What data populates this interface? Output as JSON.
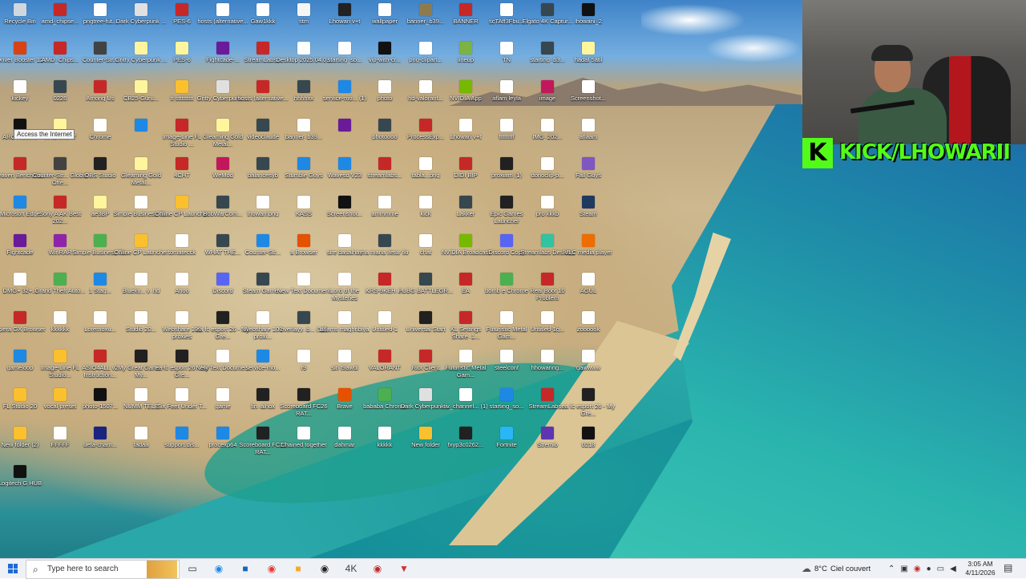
{
  "tooltip": "Access the Internet",
  "desktop_icons": [
    {
      "label": "Recycle Bin",
      "color": "#cfd8dc"
    },
    {
      "label": "amd_chipse...",
      "color": "#c62828"
    },
    {
      "label": "pngtree-fut...",
      "color": "#ffffff"
    },
    {
      "label": "Dark Cyberpunk ...",
      "color": "#e0e0e0"
    },
    {
      "label": "PES-6",
      "color": "#c62828"
    },
    {
      "label": "hosts (alternative...",
      "color": "#ffffff"
    },
    {
      "label": "Gaw1kkk",
      "color": "#ffffff"
    },
    {
      "label": "stm",
      "color": "#f5f5f5"
    },
    {
      "label": "Lhowari v+t",
      "color": "#222222"
    },
    {
      "label": "wallpaper",
      "color": "#ffffff"
    },
    {
      "label": "banner_b39...",
      "color": "#8d7b4f"
    },
    {
      "label": "BANNER",
      "color": "#c62828"
    },
    {
      "label": "scTAff3Fbu...",
      "color": "#ffffff"
    },
    {
      "label": "Elgato 4K Captur...",
      "color": "#37474f"
    },
    {
      "label": "lhowarii_2",
      "color": "#111111"
    },
    {
      "label": "Driver Booster 12",
      "color": "#d84315"
    },
    {
      "label": "AMD_Chips...",
      "color": "#c62828"
    },
    {
      "label": "Counter-Str...",
      "color": "#424242"
    },
    {
      "label": "Gritty Cyberpunk ...",
      "color": "#fff59d"
    },
    {
      "label": "PES-6",
      "color": "#fff59d"
    },
    {
      "label": "Fightcade-...",
      "color": "#6a1b9a"
    },
    {
      "label": "StreamLabs...",
      "color": "#c62828"
    },
    {
      "label": "Desktop 2025.04.0...",
      "color": "#ffffff"
    },
    {
      "label": "starting_so...",
      "color": "#ffffff"
    },
    {
      "label": "vip-with-cr...",
      "color": "#111111"
    },
    {
      "label": "png-clipart...",
      "color": "#ffffff"
    },
    {
      "label": "lineup",
      "color": "#7cb342"
    },
    {
      "label": "TN",
      "color": "#ffffff"
    },
    {
      "label": "starting_b3...",
      "color": "#37474f"
    },
    {
      "label": "hadaf 5atil",
      "color": "#fff59d"
    },
    {
      "label": "kickey",
      "color": "#ffffff"
    },
    {
      "label": "0226",
      "color": "#37474f"
    },
    {
      "label": "Among Us",
      "color": "#c62828"
    },
    {
      "label": "CB25-Guru...",
      "color": "#fff59d"
    },
    {
      "label": "ft sttttttttt",
      "color": "#fbc02d"
    },
    {
      "label": "Gritty Cyberpunk ...",
      "color": "#e0e0e0"
    },
    {
      "label": "hosts (alternative...",
      "color": "#c62828"
    },
    {
      "label": "hhhhxx",
      "color": "#37474f"
    },
    {
      "label": "service-mo... (1)",
      "color": "#1e88e5"
    },
    {
      "label": "photo",
      "color": "#ffffff"
    },
    {
      "label": "hd-valorant...",
      "color": "#ffffff"
    },
    {
      "label": "NVIDIA App",
      "color": "#76b900"
    },
    {
      "label": "aflam leyla",
      "color": "#ffffff"
    },
    {
      "label": "image",
      "color": "#c2185b"
    },
    {
      "label": "Screenshot...",
      "color": "#ffffff"
    },
    {
      "label": "ARC Raiders",
      "color": "#111111"
    },
    {
      "label": "deepfakeRT",
      "color": "#fff59d"
    },
    {
      "label": "Chrome",
      "color": "#ffffff"
    },
    {
      "label": "",
      "color": "#1e88e5"
    },
    {
      "label": "Image-Line FL Studio ...",
      "color": "#c62828"
    },
    {
      "label": "Gleaming Gold Metal...",
      "color": "#fff59d"
    },
    {
      "label": "videoclaude",
      "color": "#37474f"
    },
    {
      "label": "banner_b39...",
      "color": "#ffffff"
    },
    {
      "label": "",
      "color": "#6a1b9a"
    },
    {
      "label": "photoooo",
      "color": "#37474f"
    },
    {
      "label": "ProcessExp...",
      "color": "#c62828"
    },
    {
      "label": "Lhowari v+t",
      "color": "#ffffff"
    },
    {
      "label": "ffffffffff",
      "color": "#ffffff"
    },
    {
      "label": "IMG_202...",
      "color": "#ffffff"
    },
    {
      "label": "aflaam",
      "color": "#ffffff"
    },
    {
      "label": "Heaven Benchma...",
      "color": "#c62828"
    },
    {
      "label": "Counter-Str... Global Offe...",
      "color": "#424242"
    },
    {
      "label": "OBS Studio",
      "color": "#212121"
    },
    {
      "label": "Gleaming Gold Metal...",
      "color": "#fff59d"
    },
    {
      "label": "4CHT",
      "color": "#c62828"
    },
    {
      "label": "WeMod",
      "color": "#c2185b"
    },
    {
      "label": "balancesyb",
      "color": "#37474f"
    },
    {
      "label": "Stumble Guys",
      "color": "#1e88e5"
    },
    {
      "label": "Wavesd V23",
      "color": "#1e88e5"
    },
    {
      "label": "streamlabs...",
      "color": "#c62828"
    },
    {
      "label": "tabla...png",
      "color": "#ffffff"
    },
    {
      "label": "DIDI BIP",
      "color": "#c62828"
    },
    {
      "label": "proxiam (1)",
      "color": "#212121"
    },
    {
      "label": "donoclip-p...",
      "color": "#ffffff"
    },
    {
      "label": "Fall Guys",
      "color": "#7e57c2"
    },
    {
      "label": "Microsoft Edge",
      "color": "#1e88e5"
    },
    {
      "label": "Sony A AK Best 202...",
      "color": "#c62828"
    },
    {
      "label": "ae3BP",
      "color": "#fff59d"
    },
    {
      "label": "Simple Business Ti...",
      "color": "#ffffff"
    },
    {
      "label": "Online CP Launcher",
      "color": "#fbc02d"
    },
    {
      "label": "BobWarCom...",
      "color": "#37474f"
    },
    {
      "label": "lhowarripng",
      "color": "#ffffff"
    },
    {
      "label": "KASS",
      "color": "#ffffff"
    },
    {
      "label": "Screenshot...",
      "color": "#111111"
    },
    {
      "label": "ammmme",
      "color": "#ffffff"
    },
    {
      "label": "kick",
      "color": "#ffffff"
    },
    {
      "label": "Lakker",
      "color": "#37474f"
    },
    {
      "label": "Epic Games Launcher",
      "color": "#212121"
    },
    {
      "label": "pro kkkb",
      "color": "#ffffff"
    },
    {
      "label": "Steam",
      "color": "#1e3a5f"
    },
    {
      "label": "Fightcade",
      "color": "#6a1b9a"
    },
    {
      "label": "WinRAR",
      "color": "#8e24aa"
    },
    {
      "label": "Simple Business Ti...",
      "color": "#4caf50"
    },
    {
      "label": "Online CP Launcher",
      "color": "#fbc02d"
    },
    {
      "label": "tomatecck",
      "color": "#ffffff"
    },
    {
      "label": "WHAT THE...",
      "color": "#37474f"
    },
    {
      "label": "Counter-Str...",
      "color": "#1e88e5"
    },
    {
      "label": "a Browser",
      "color": "#e65100"
    },
    {
      "label": "sire basalhay",
      "color": "#ffffff"
    },
    {
      "label": "ma mana lfetur fkr",
      "color": "#37474f"
    },
    {
      "label": "chat",
      "color": "#ffffff"
    },
    {
      "label": "NVIDIA Broadcast",
      "color": "#76b900"
    },
    {
      "label": "Discord Copy",
      "color": "#5865f2"
    },
    {
      "label": "Streamlabs Desktop",
      "color": "#31c3a2"
    },
    {
      "label": "VLC media player",
      "color": "#ef6c00"
    },
    {
      "label": "DMG+ 32+...",
      "color": "#ffffff"
    },
    {
      "label": "Grand Theft Auto...",
      "color": "#4caf50"
    },
    {
      "label": "1 Stag...",
      "color": "#1e88e5"
    },
    {
      "label": "Blueky... y_hd",
      "color": "#ffffff"
    },
    {
      "label": "Ahoo",
      "color": "#ffffff"
    },
    {
      "label": "Discord",
      "color": "#5865f2"
    },
    {
      "label": "Steam Game...",
      "color": "#37474f"
    },
    {
      "label": "New Text Document",
      "color": "#ffffff"
    },
    {
      "label": "Lord of the Mysteries",
      "color": "#ffffff"
    },
    {
      "label": "KRS-9KEH_...",
      "color": "#c62828"
    },
    {
      "label": "PUBG BATTLEGR...",
      "color": "#37474f"
    },
    {
      "label": "EA",
      "color": "#c62828"
    },
    {
      "label": "bomb e Chrome",
      "color": "#4caf50"
    },
    {
      "label": "Real Boot 10 Problem",
      "color": "#c62828"
    },
    {
      "label": "AGUL",
      "color": "#ffffff"
    },
    {
      "label": "Opera GX Browser",
      "color": "#c62828"
    },
    {
      "label": "kkkkkk",
      "color": "#ffffff"
    },
    {
      "label": "Loremoxu...",
      "color": "#ffffff"
    },
    {
      "label": "Studio 20...",
      "color": "#ffffff"
    },
    {
      "label": "Webshare 100 proxies",
      "color": "#ffffff"
    },
    {
      "label": "ea fc esport 26 - My Gre...",
      "color": "#212121"
    },
    {
      "label": "Webshare 100 proxi...",
      "color": "#ffffff"
    },
    {
      "label": "overlayy_b... (12)",
      "color": "#37474f"
    },
    {
      "label": "aflams maghribiya",
      "color": "#ffffff"
    },
    {
      "label": "Untitled-1",
      "color": "#ffffff"
    },
    {
      "label": "Universal Start",
      "color": "#212121"
    },
    {
      "label": "KL Settings Share_1...",
      "color": "#c62828"
    },
    {
      "label": "Futuristic Metal Gam...",
      "color": "#ffffff"
    },
    {
      "label": "Untitled-1g...",
      "color": "#ffffff"
    },
    {
      "label": "zoooook",
      "color": "#ffffff"
    },
    {
      "label": "gameloop",
      "color": "#1e88e5"
    },
    {
      "label": "Image-Line FL Studio...",
      "color": "#fbc02d"
    },
    {
      "label": "ASIO4ALL v2 Instruction...",
      "color": "#c62828"
    },
    {
      "label": "My Great Game - My...",
      "color": "#212121"
    },
    {
      "label": "ea fc esport 26 - My Gre...",
      "color": "#212121"
    },
    {
      "label": "New Text Docume...",
      "color": "#ffffff"
    },
    {
      "label": "service-mo...",
      "color": "#1e88e5"
    },
    {
      "label": "r9",
      "color": "#ffffff"
    },
    {
      "label": "siri t9awdi",
      "color": "#ffffff"
    },
    {
      "label": "VALORANT",
      "color": "#c62828"
    },
    {
      "label": "Riot Client",
      "color": "#c62828"
    },
    {
      "label": "Futuristic Metal Gam...",
      "color": "#ffffff"
    },
    {
      "label": "steelconf",
      "color": "#ffffff"
    },
    {
      "label": "hhowaring...",
      "color": "#ffffff"
    },
    {
      "label": "gawwww",
      "color": "#ffffff"
    },
    {
      "label": "FL Studio 20",
      "color": "#fbc02d"
    },
    {
      "label": "vocal preset",
      "color": "#fbc02d"
    },
    {
      "label": "photo-1507...",
      "color": "#111111"
    },
    {
      "label": "NUMM TELE",
      "color": "#ffffff"
    },
    {
      "label": "Six Feet Under T...",
      "color": "#ffffff"
    },
    {
      "label": "game",
      "color": "#ffffff"
    },
    {
      "label": "fin_alhox",
      "color": "#212121"
    },
    {
      "label": "Scoreboard FC26 RAT...",
      "color": "#212121"
    },
    {
      "label": "Brave",
      "color": "#e65100"
    },
    {
      "label": "bababa Chrome",
      "color": "#4caf50"
    },
    {
      "label": "Dark Cyberpunk ...",
      "color": "#e0e0e0"
    },
    {
      "label": "tiv_channel... (1)",
      "color": "#ffffff"
    },
    {
      "label": "starting_so...",
      "color": "#1e88e5"
    },
    {
      "label": "StreamLabs...",
      "color": "#c62828"
    },
    {
      "label": "ea fc esport 26 - My Gre...",
      "color": "#212121"
    },
    {
      "label": "New folder (2)",
      "color": "#fbc02d"
    },
    {
      "label": "FFFFF",
      "color": "#ffffff"
    },
    {
      "label": "uefa-cham...",
      "color": "#1a237e"
    },
    {
      "label": "fadaa",
      "color": "#ffffff"
    },
    {
      "label": "support.dis...",
      "color": "#1e88e5"
    },
    {
      "label": "procexp64",
      "color": "#1e88e5"
    },
    {
      "label": "Scoreboard FC26 RAT...",
      "color": "#212121"
    },
    {
      "label": "Chained together",
      "color": "#ffffff"
    },
    {
      "label": "dahmar",
      "color": "#ffffff"
    },
    {
      "label": "kkkkk",
      "color": "#ffffff"
    },
    {
      "label": "New folder",
      "color": "#fbc02d"
    },
    {
      "label": "fxyp3c0262...",
      "color": "#212121"
    },
    {
      "label": "Fortnite",
      "color": "#29b6f6"
    },
    {
      "label": "Stremio",
      "color": "#5e35b1"
    },
    {
      "label": "0218",
      "color": "#111111"
    },
    {
      "label": "Logitech G HUB",
      "color": "#111111"
    }
  ],
  "webcam": {
    "overlay_text": "KICK/LHOWARII",
    "logo_letter": "K",
    "accent": "#53fc18"
  },
  "taskbar": {
    "search_placeholder": "Type here to search",
    "pinned": [
      {
        "name": "task-view",
        "color": "#333333",
        "glyph": "▭"
      },
      {
        "name": "edge",
        "color": "#1e88e5",
        "glyph": "◉"
      },
      {
        "name": "outlook",
        "color": "#1565c0",
        "glyph": "■"
      },
      {
        "name": "chrome",
        "color": "#e53935",
        "glyph": "◉"
      },
      {
        "name": "file-explorer",
        "color": "#f9a825",
        "glyph": "■"
      },
      {
        "name": "obs",
        "color": "#212121",
        "glyph": "◉"
      },
      {
        "name": "elgato",
        "color": "#37474f",
        "glyph": "4K"
      },
      {
        "name": "streamlabs",
        "color": "#c62828",
        "glyph": "◉"
      },
      {
        "name": "app-red",
        "color": "#d32f2f",
        "glyph": "▼"
      }
    ],
    "weather_temp": "8°C",
    "weather_text": "Ciel couvert",
    "time": "3:05 AM",
    "date": "4/11/2026"
  }
}
